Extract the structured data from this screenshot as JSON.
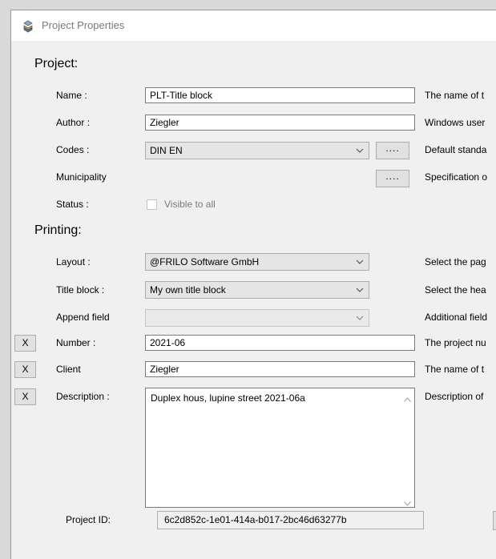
{
  "window": {
    "title": "Project Properties",
    "icon": "project-icon"
  },
  "project": {
    "heading": "Project:",
    "name": {
      "label": "Name :",
      "value": "PLT-Title block",
      "desc": "The name of t"
    },
    "author": {
      "label": "Author :",
      "value": "Ziegler",
      "desc": "Windows user"
    },
    "codes": {
      "label": "Codes :",
      "value": "DIN EN",
      "button": "....",
      "desc": "Default standa"
    },
    "municipality": {
      "label": "Municipality",
      "button": "....",
      "desc": "Specification o"
    },
    "status": {
      "label": "Status :",
      "checkbox_label": "Visible to all",
      "checked": false
    }
  },
  "printing": {
    "heading": "Printing:",
    "layout": {
      "label": "Layout :",
      "value": "@FRILO Software GmbH",
      "desc": "Select the pag"
    },
    "title_block": {
      "label": "Title block :",
      "value": "My own title block",
      "desc": "Select the hea"
    },
    "append_field": {
      "label": "Append field",
      "value": "",
      "desc": "Additional field"
    },
    "number": {
      "x": "X",
      "label": "Number :",
      "value": "2021-06",
      "desc": "The project nu"
    },
    "client": {
      "x": "X",
      "label": "Client",
      "value": "Ziegler",
      "desc": "The name of t"
    },
    "description": {
      "x": "X",
      "label": "Description :",
      "value": "Duplex hous, lupine street 2021-06a",
      "desc": "Description of"
    }
  },
  "footer": {
    "project_id_label": "Project ID:",
    "project_id": "6c2d852c-1e01-414a-b017-2bc46d63277b"
  }
}
